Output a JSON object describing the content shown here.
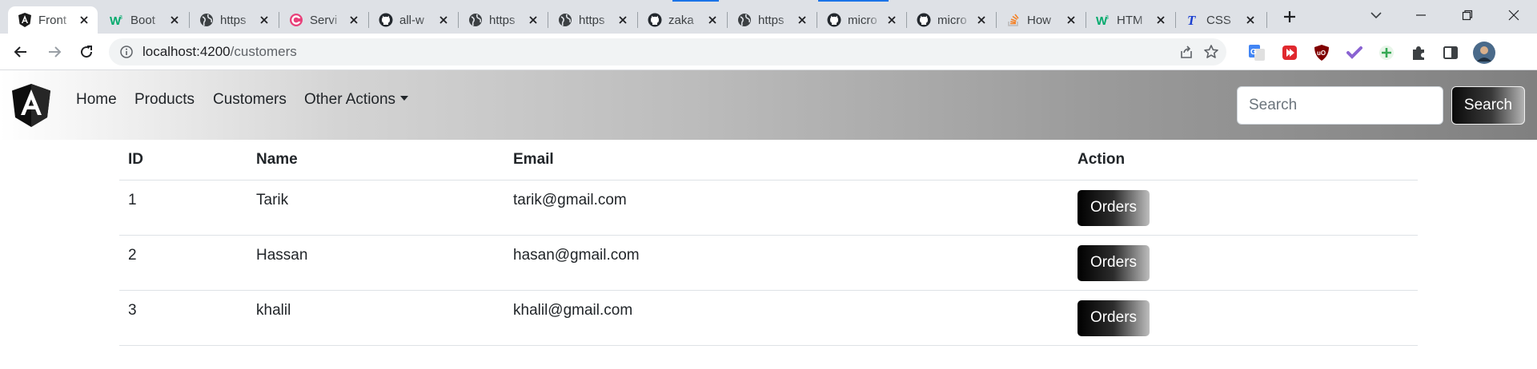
{
  "browser": {
    "tabs": [
      {
        "title": "Front",
        "icon": "angular-icon",
        "active": true
      },
      {
        "title": "Boot",
        "icon": "w3schools-icon"
      },
      {
        "title": "https",
        "icon": "globe-icon"
      },
      {
        "title": "Servi",
        "icon": "c-logo-icon"
      },
      {
        "title": "all-w",
        "icon": "github-icon"
      },
      {
        "title": "https",
        "icon": "globe-icon"
      },
      {
        "title": "https",
        "icon": "globe-icon"
      },
      {
        "title": "zaka",
        "icon": "github-icon"
      },
      {
        "title": "https",
        "icon": "globe-icon"
      },
      {
        "title": "micro",
        "icon": "github-icon"
      },
      {
        "title": "micro",
        "icon": "github-icon"
      },
      {
        "title": "How",
        "icon": "stackoverflow-icon"
      },
      {
        "title": "HTM",
        "icon": "w3schools-icon"
      },
      {
        "title": "CSS",
        "icon": "t-icon"
      }
    ],
    "address": {
      "host": "localhost:4200",
      "path": "/customers"
    }
  },
  "colors": {
    "accent_loading": "#1a73e8",
    "navbar_gradient": [
      "#ffffff",
      "#808080"
    ],
    "button_gradient": [
      "#000000",
      "#bdbdbd"
    ]
  },
  "navbar": {
    "links": [
      "Home",
      "Products",
      "Customers",
      "Other Actions"
    ],
    "search": {
      "placeholder": "Search",
      "button_label": "Search"
    }
  },
  "table": {
    "headers": [
      "ID",
      "Name",
      "Email",
      "Action"
    ],
    "rows": [
      {
        "id": "1",
        "name": "Tarik",
        "email": "tarik@gmail.com",
        "action": "Orders"
      },
      {
        "id": "2",
        "name": "Hassan",
        "email": "hasan@gmail.com",
        "action": "Orders"
      },
      {
        "id": "3",
        "name": "khalil",
        "email": "khalil@gmail.com",
        "action": "Orders"
      }
    ]
  }
}
